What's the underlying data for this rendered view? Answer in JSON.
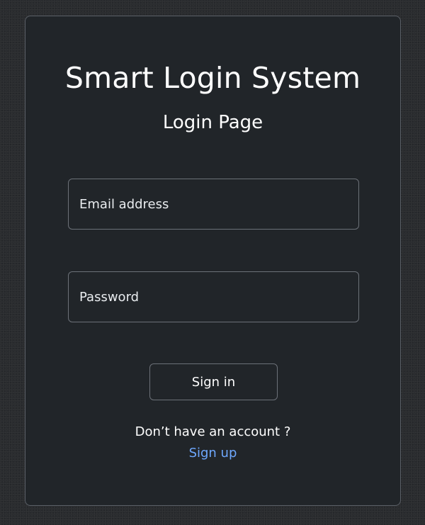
{
  "header": {
    "app_title": "Smart Login System",
    "page_subtitle": "Login Page"
  },
  "form": {
    "email": {
      "value": "",
      "placeholder": "Email address"
    },
    "password": {
      "value": "",
      "placeholder": "Password"
    },
    "submit_label": "Sign in"
  },
  "footer": {
    "account_prompt": "Don’t have an account ?",
    "signup_label": "Sign up"
  },
  "colors": {
    "page_background": "#2a2c2f",
    "card_background": "#212529",
    "border": "#6c7178",
    "link": "#6ea8fe",
    "text": "#ffffff"
  }
}
